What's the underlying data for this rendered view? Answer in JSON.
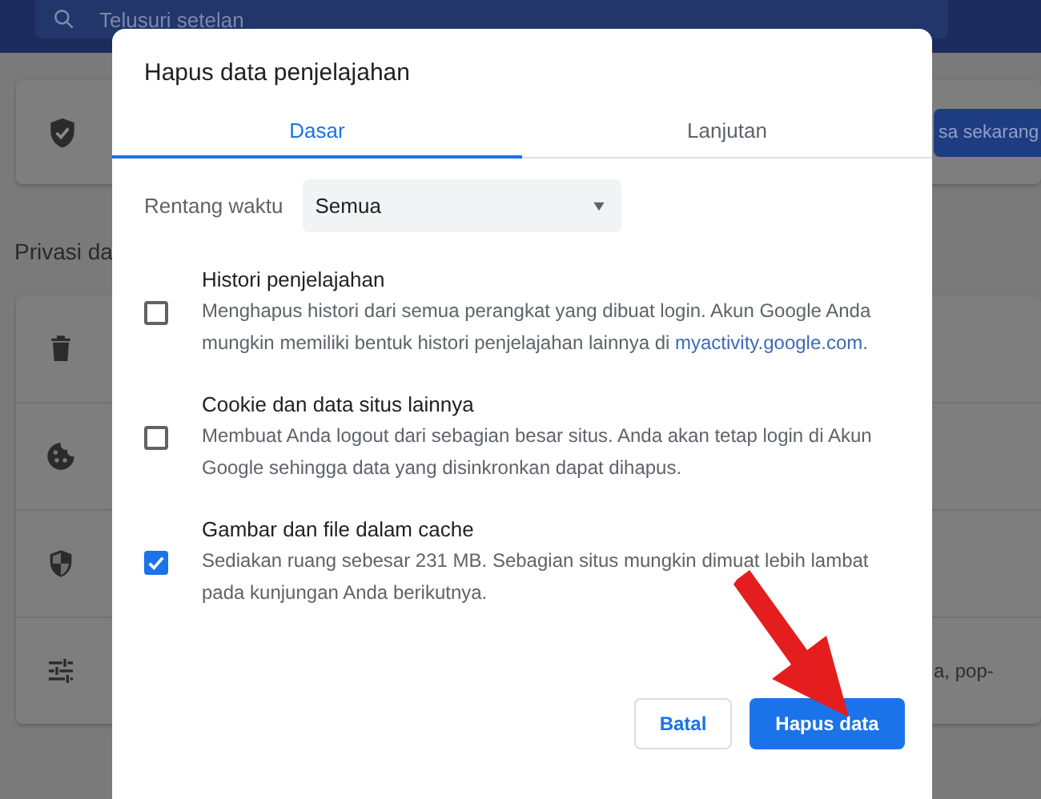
{
  "search": {
    "placeholder": "Telusuri setelan"
  },
  "background": {
    "safety_button": "sa sekarang",
    "section_title": "Privasi da",
    "row_text": "a, pop-"
  },
  "dialog": {
    "title": "Hapus data penjelajahan",
    "tabs": [
      {
        "label": "Dasar",
        "selected": true
      },
      {
        "label": "Lanjutan",
        "selected": false
      }
    ],
    "time_range": {
      "label": "Rentang waktu",
      "value": "Semua"
    },
    "options": [
      {
        "title": "Histori penjelajahan",
        "description": "Menghapus histori dari semua perangkat yang dibuat login. Akun Google Anda mungkin memiliki bentuk histori penjelajahan lainnya di ",
        "link": "myactivity.google.com",
        "after_link": ".",
        "checked": false
      },
      {
        "title": "Cookie dan data situs lainnya",
        "description": "Membuat Anda logout dari sebagian besar situs. Anda akan tetap login di Akun Google sehingga data yang disinkronkan dapat dihapus.",
        "checked": false
      },
      {
        "title": "Gambar dan file dalam cache",
        "description": "Sediakan ruang sebesar 231 MB. Sebagian situs mungkin dimuat lebih lambat pada kunjungan Anda berikutnya.",
        "checked": true
      }
    ],
    "buttons": [
      {
        "label": "Batal",
        "kind": "secondary"
      },
      {
        "label": "Hapus data",
        "kind": "primary"
      }
    ]
  }
}
